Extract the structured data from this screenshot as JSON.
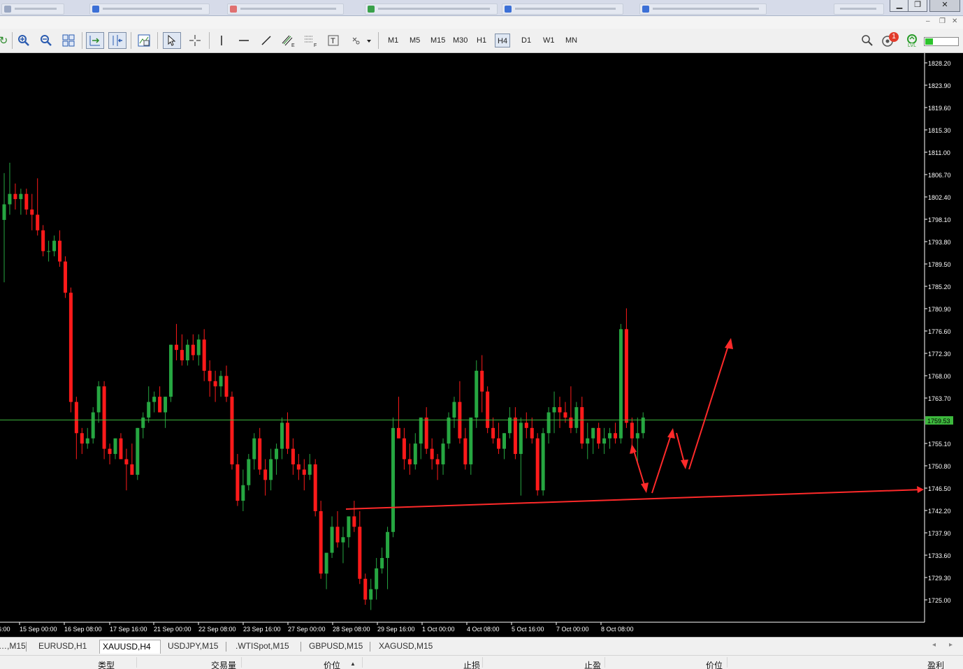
{
  "toolbar": {
    "timeframes": [
      "M1",
      "M5",
      "M15",
      "M30",
      "H1",
      "H4",
      "D1",
      "W1",
      "MN"
    ],
    "active_timeframe": "H4",
    "alerts_badge": "1",
    "lvl_label": "LVL"
  },
  "chart_tabs": [
    {
      "label": "…,M15",
      "active": false
    },
    {
      "label": "EURUSD,H1",
      "active": false
    },
    {
      "label": "XAUUSD,H4",
      "active": true
    },
    {
      "label": "USDJPY,M15",
      "active": false
    },
    {
      "label": ".WTISpot,M15",
      "active": false
    },
    {
      "label": "GBPUSD,M15",
      "active": false
    },
    {
      "label": "XAGUSD,M15",
      "active": false
    }
  ],
  "table_headers": [
    "类型",
    "交易量",
    "价位",
    "止损",
    "止盈",
    "价位",
    "盈利"
  ],
  "colors": {
    "bull": "#26a641",
    "bear": "#ff1a1a",
    "price_line": "#3db83d",
    "annotation": "#ff2a2a",
    "background": "#000000",
    "axis_text": "#ffffff"
  },
  "chart_data": {
    "type": "candlestick",
    "symbol": "XAUUSD",
    "timeframe": "H4",
    "current_price": "1759.53",
    "y_ticks": [
      "1828.20",
      "1823.90",
      "1819.60",
      "1815.30",
      "1811.00",
      "1806.70",
      "1802.40",
      "1798.10",
      "1793.80",
      "1789.50",
      "1785.20",
      "1780.90",
      "1776.60",
      "1772.30",
      "1768.00",
      "1763.70",
      "1759.53",
      "1755.10",
      "1750.80",
      "1746.50",
      "1742.20",
      "1737.90",
      "1733.60",
      "1729.30",
      "1725.00"
    ],
    "x_ticks": [
      "…6:00",
      "15 Sep 00:00",
      "16 Sep 08:00",
      "17 Sep 16:00",
      "21 Sep 00:00",
      "22 Sep 08:00",
      "23 Sep 16:00",
      "27 Sep 00:00",
      "28 Sep 08:00",
      "29 Sep 16:00",
      "1 Oct 00:00",
      "4 Oct 08:00",
      "5 Oct 16:00",
      "7 Oct 00:00",
      "8 Oct 08:00"
    ],
    "ylim": [
      1723.0,
      1830.0
    ],
    "candles": [
      [
        1798,
        1807,
        1786,
        1801
      ],
      [
        1801,
        1809,
        1799,
        1803
      ],
      [
        1803,
        1805,
        1800,
        1802
      ],
      [
        1802,
        1804,
        1799,
        1803
      ],
      [
        1803,
        1804,
        1799,
        1800
      ],
      [
        1800,
        1803,
        1796,
        1799
      ],
      [
        1799,
        1806,
        1795,
        1796
      ],
      [
        1796,
        1797,
        1791,
        1792
      ],
      [
        1792,
        1794,
        1790,
        1792
      ],
      [
        1792,
        1795,
        1791,
        1794
      ],
      [
        1794,
        1796,
        1789,
        1790
      ],
      [
        1790,
        1791,
        1783,
        1784
      ],
      [
        1784,
        1785,
        1761,
        1763
      ],
      [
        1763,
        1764,
        1752,
        1757
      ],
      [
        1757,
        1758,
        1753,
        1755
      ],
      [
        1755,
        1758,
        1754,
        1756
      ],
      [
        1756,
        1762,
        1755,
        1761
      ],
      [
        1761,
        1767,
        1759,
        1766
      ],
      [
        1766,
        1767,
        1752,
        1754
      ],
      [
        1754,
        1755,
        1751,
        1753
      ],
      [
        1753,
        1756,
        1752,
        1756
      ],
      [
        1756,
        1757,
        1752,
        1752
      ],
      [
        1752,
        1754,
        1746,
        1751
      ],
      [
        1751,
        1755,
        1749,
        1749
      ],
      [
        1749,
        1758,
        1748,
        1758
      ],
      [
        1758,
        1761,
        1756,
        1760
      ],
      [
        1760,
        1766,
        1759,
        1763
      ],
      [
        1763,
        1765,
        1761,
        1764
      ],
      [
        1764,
        1766,
        1761,
        1761
      ],
      [
        1761,
        1764,
        1758,
        1764
      ],
      [
        1764,
        1774,
        1763,
        1774
      ],
      [
        1774,
        1778,
        1771,
        1773
      ],
      [
        1773,
        1776,
        1770,
        1771
      ],
      [
        1771,
        1775,
        1770,
        1774
      ],
      [
        1774,
        1776,
        1771,
        1772
      ],
      [
        1772,
        1776,
        1770,
        1775
      ],
      [
        1775,
        1777,
        1767,
        1769
      ],
      [
        1769,
        1771,
        1764,
        1767
      ],
      [
        1767,
        1769,
        1763,
        1766
      ],
      [
        1766,
        1769,
        1764,
        1768
      ],
      [
        1768,
        1770,
        1763,
        1764
      ],
      [
        1764,
        1765,
        1750,
        1751
      ],
      [
        1751,
        1753,
        1743,
        1744
      ],
      [
        1744,
        1750,
        1742,
        1747
      ],
      [
        1747,
        1753,
        1746,
        1752
      ],
      [
        1752,
        1757,
        1750,
        1756
      ],
      [
        1756,
        1758,
        1749,
        1750
      ],
      [
        1750,
        1752,
        1745,
        1748
      ],
      [
        1748,
        1754,
        1746,
        1752
      ],
      [
        1752,
        1755,
        1749,
        1754
      ],
      [
        1754,
        1760,
        1752,
        1759
      ],
      [
        1759,
        1761,
        1753,
        1754
      ],
      [
        1754,
        1756,
        1749,
        1751
      ],
      [
        1751,
        1753,
        1748,
        1750
      ],
      [
        1750,
        1752,
        1746,
        1749
      ],
      [
        1749,
        1753,
        1748,
        1751
      ],
      [
        1751,
        1752,
        1741,
        1742
      ],
      [
        1742,
        1744,
        1729,
        1730
      ],
      [
        1730,
        1733,
        1727,
        1734
      ],
      [
        1734,
        1741,
        1733,
        1739
      ],
      [
        1739,
        1742,
        1735,
        1736
      ],
      [
        1736,
        1739,
        1732,
        1737
      ],
      [
        1737,
        1741,
        1735,
        1741
      ],
      [
        1741,
        1744,
        1738,
        1739
      ],
      [
        1739,
        1742,
        1728,
        1729
      ],
      [
        1729,
        1730,
        1724,
        1725
      ],
      [
        1725,
        1729,
        1723,
        1727
      ],
      [
        1727,
        1733,
        1725,
        1731
      ],
      [
        1731,
        1735,
        1730,
        1733
      ],
      [
        1733,
        1739,
        1727,
        1738
      ],
      [
        1738,
        1760,
        1737,
        1758
      ],
      [
        1758,
        1764,
        1756,
        1756
      ],
      [
        1756,
        1758,
        1750,
        1752
      ],
      [
        1752,
        1755,
        1749,
        1751
      ],
      [
        1751,
        1757,
        1750,
        1755
      ],
      [
        1755,
        1760,
        1752,
        1760
      ],
      [
        1760,
        1762,
        1753,
        1754
      ],
      [
        1754,
        1756,
        1750,
        1752
      ],
      [
        1752,
        1753,
        1748,
        1751
      ],
      [
        1751,
        1756,
        1749,
        1755
      ],
      [
        1755,
        1761,
        1754,
        1760
      ],
      [
        1760,
        1764,
        1758,
        1763
      ],
      [
        1763,
        1767,
        1755,
        1756
      ],
      [
        1756,
        1758,
        1750,
        1751
      ],
      [
        1751,
        1760,
        1749,
        1760
      ],
      [
        1760,
        1771,
        1758,
        1769
      ],
      [
        1769,
        1772,
        1761,
        1765
      ],
      [
        1765,
        1766,
        1757,
        1758
      ],
      [
        1758,
        1760,
        1755,
        1756
      ],
      [
        1756,
        1759,
        1753,
        1754
      ],
      [
        1754,
        1757,
        1752,
        1757
      ],
      [
        1757,
        1762,
        1756,
        1760
      ],
      [
        1760,
        1762,
        1752,
        1753
      ],
      [
        1753,
        1760,
        1745,
        1759
      ],
      [
        1759,
        1761,
        1756,
        1758
      ],
      [
        1758,
        1760,
        1755,
        1756
      ],
      [
        1756,
        1757,
        1745,
        1746
      ],
      [
        1746,
        1758,
        1745,
        1757
      ],
      [
        1757,
        1762,
        1755,
        1761
      ],
      [
        1761,
        1765,
        1757,
        1762
      ],
      [
        1762,
        1764,
        1758,
        1761
      ],
      [
        1761,
        1763,
        1759,
        1760
      ],
      [
        1760,
        1766,
        1757,
        1758
      ],
      [
        1758,
        1763,
        1757,
        1762
      ],
      [
        1762,
        1764,
        1754,
        1755
      ],
      [
        1755,
        1759,
        1752,
        1756
      ],
      [
        1756,
        1758,
        1753,
        1758
      ],
      [
        1758,
        1759,
        1754,
        1755
      ],
      [
        1755,
        1758,
        1753,
        1756
      ],
      [
        1756,
        1758,
        1754,
        1757
      ],
      [
        1757,
        1759,
        1755,
        1756
      ],
      [
        1756,
        1778,
        1755,
        1777
      ],
      [
        1777,
        1781,
        1758,
        1759
      ],
      [
        1759,
        1760,
        1753,
        1756
      ],
      [
        1756,
        1760,
        1751,
        1757
      ],
      [
        1757,
        1761,
        1756,
        1760
      ]
    ]
  }
}
